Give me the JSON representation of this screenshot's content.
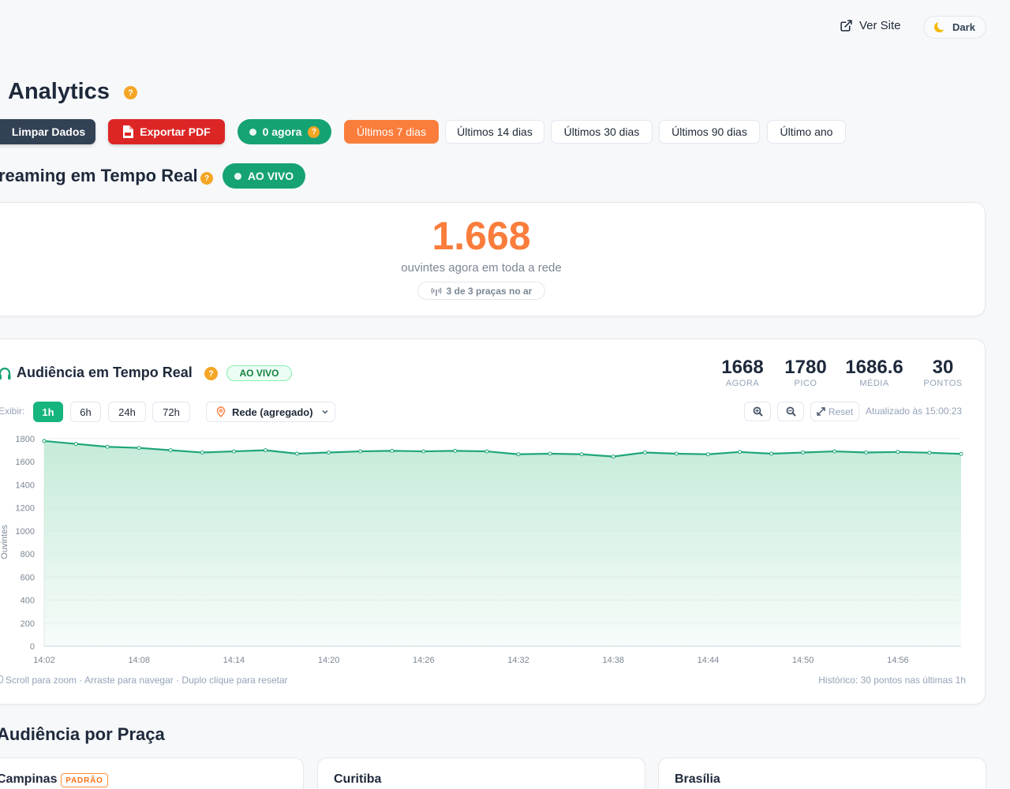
{
  "topbar": {
    "view_site_label": "Ver Site",
    "theme_label": "Dark"
  },
  "page": {
    "title": "Analytics",
    "help_glyph": "?"
  },
  "toolbar": {
    "clear_label": "Limpar Dados",
    "export_label": "Exportar PDF",
    "live_label": "0 agora",
    "ranges": [
      "Últimos 7 dias",
      "Últimos 14 dias",
      "Últimos 30 dias",
      "Últimos 90 dias",
      "Último ano"
    ],
    "active_range": "Últimos 7 dias"
  },
  "streaming": {
    "title": "reaming em Tempo Real",
    "live_pill": "AO VIVO",
    "listeners_now": "1.668",
    "listeners_caption": "ouvintes agora em toda a rede",
    "pracas_status": "3 de 3 praças no ar"
  },
  "audience": {
    "title": "Audiência em Tempo Real",
    "live_badge": "AO VIVO",
    "stats": [
      {
        "value": "1668",
        "label": "AGORA"
      },
      {
        "value": "1780",
        "label": "PICO"
      },
      {
        "value": "1686.6",
        "label": "MÉDIA"
      },
      {
        "value": "30",
        "label": "PONTOS"
      }
    ],
    "show_label": "Exibir:",
    "windows": [
      "1h",
      "6h",
      "24h",
      "72h"
    ],
    "active_window": "1h",
    "network_select": "Rede (agregado)",
    "reset_label": "Reset",
    "updated_at": "Atualizado às 15:00:23",
    "hint": "Scroll para zoom · Arraste para navegar · Duplo clique para resetar",
    "history": "Histórico: 30 pontos nas últimas 1h"
  },
  "chart_data": {
    "type": "area",
    "ylabel": "Ouvintes",
    "xlabel": "",
    "ylim": [
      0,
      1800
    ],
    "yticks": [
      0,
      200,
      400,
      600,
      800,
      1000,
      1200,
      1400,
      1600,
      1800
    ],
    "xticks": [
      "14:02",
      "14:08",
      "14:14",
      "14:20",
      "14:26",
      "14:32",
      "14:38",
      "14:44",
      "14:50",
      "14:56"
    ],
    "series": [
      {
        "values": [
          1780,
          1755,
          1730,
          1720,
          1700,
          1680,
          1690,
          1700,
          1670,
          1680,
          1690,
          1695,
          1690,
          1695,
          1690,
          1665,
          1670,
          1665,
          1645,
          1680,
          1670,
          1665,
          1685,
          1670,
          1680,
          1690,
          1680,
          1685,
          1678,
          1668
        ]
      }
    ],
    "colors": {
      "line": "#1fa67a",
      "fill": "#bfe9d5"
    },
    "grid": true
  },
  "pracas": {
    "title": "Audiência por Praça",
    "items": [
      {
        "name": "Campinas",
        "badge": "PADRÃO"
      },
      {
        "name": "Curitiba"
      },
      {
        "name": "Brasília"
      }
    ]
  },
  "colors": {
    "accent": "#fb7d3c",
    "live": "#16a374",
    "danger": "#dc2626",
    "help": "#f5a524"
  }
}
